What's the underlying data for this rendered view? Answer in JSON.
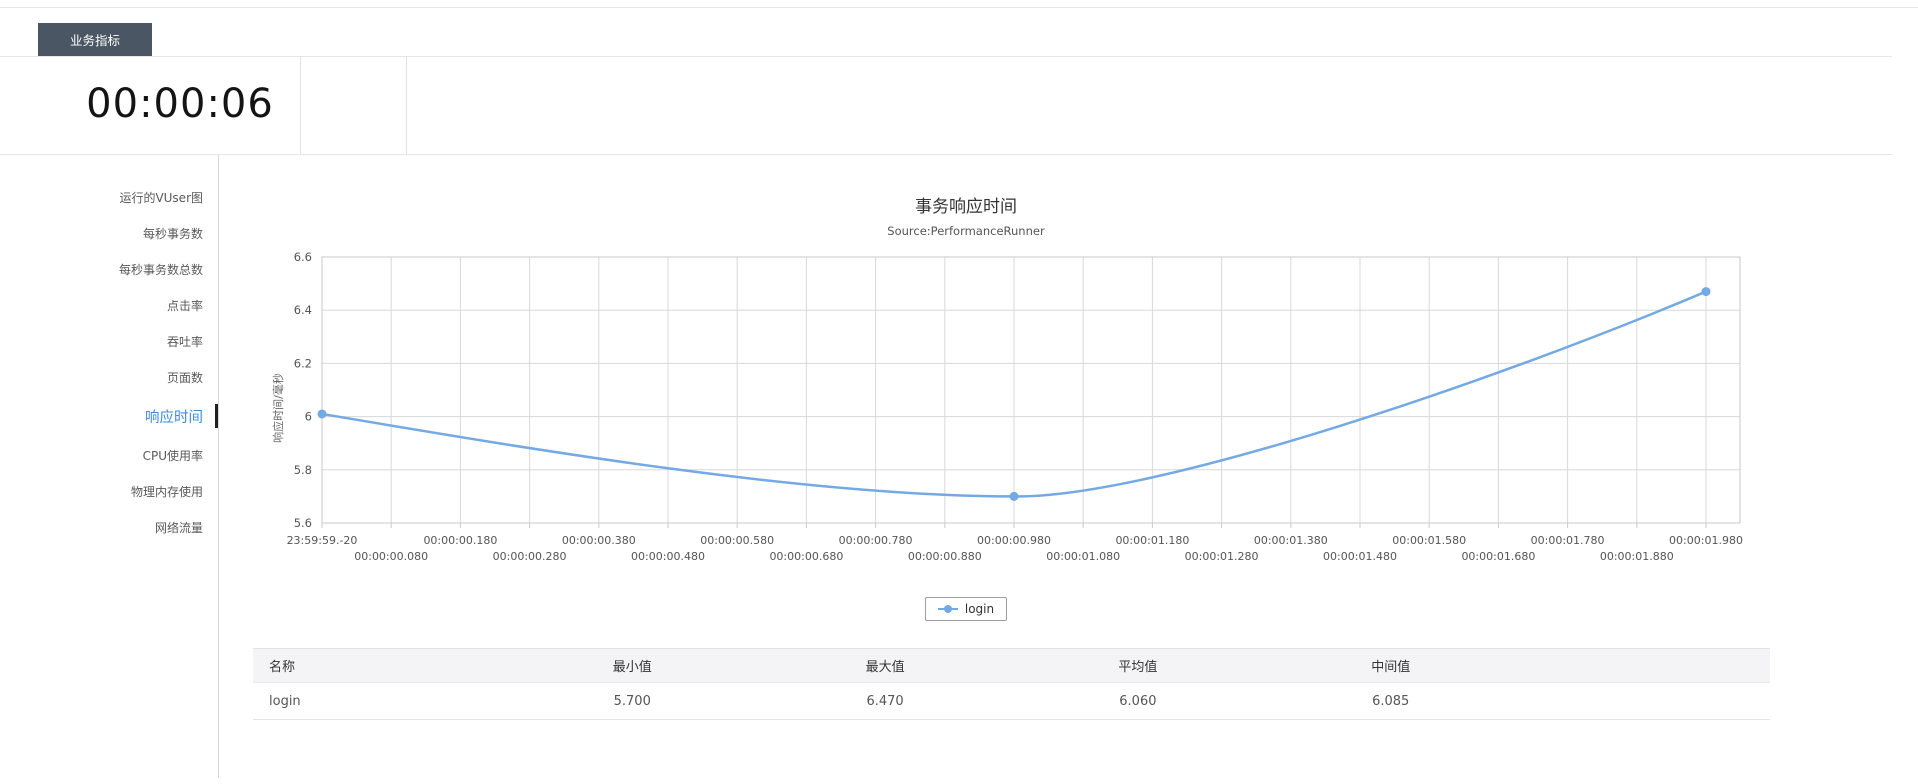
{
  "tab": {
    "label": "业务指标"
  },
  "timer": {
    "value": "00:00:06"
  },
  "sidebar": {
    "items": [
      {
        "label": "运行的VUser图",
        "active": false
      },
      {
        "label": "每秒事务数",
        "active": false
      },
      {
        "label": "每秒事务数总数",
        "active": false
      },
      {
        "label": "点击率",
        "active": false
      },
      {
        "label": "吞吐率",
        "active": false
      },
      {
        "label": "页面数",
        "active": false
      },
      {
        "label": "响应时间",
        "active": true
      },
      {
        "label": "CPU使用率",
        "active": false
      },
      {
        "label": "物理内存使用",
        "active": false
      },
      {
        "label": "网络流量",
        "active": false
      }
    ]
  },
  "chart_data": {
    "type": "line",
    "title": "事务响应时间",
    "subtitle": "Source:PerformanceRunner",
    "ylabel": "响应时间/毫秒",
    "ylim": [
      5.6,
      6.6
    ],
    "grid": true,
    "legend_position": "bottom",
    "yticks": [
      {
        "value": 6.6,
        "label": "6.6"
      },
      {
        "value": 6.4,
        "label": "6.4"
      },
      {
        "value": 6.2,
        "label": "6.2"
      },
      {
        "value": 6.0,
        "label": "6"
      },
      {
        "value": 5.8,
        "label": "5.8"
      },
      {
        "value": 5.6,
        "label": "5.6"
      }
    ],
    "xticklabels": [
      "23:59:59.-20",
      "00:00:00.080",
      "00:00:00.180",
      "00:00:00.280",
      "00:00:00.380",
      "00:00:00.480",
      "00:00:00.580",
      "00:00:00.680",
      "00:00:00.780",
      "00:00:00.880",
      "00:00:00.980",
      "00:00:01.080",
      "00:00:01.180",
      "00:00:01.280",
      "00:00:01.380",
      "00:00:01.480",
      "00:00:01.580",
      "00:00:01.680",
      "00:00:01.780",
      "00:00:01.880",
      "00:00:01.980"
    ],
    "series": [
      {
        "name": "login",
        "color": "#73a9e5",
        "points": [
          {
            "tick": 0,
            "x_label": "23:59:59.-20",
            "y": 6.01
          },
          {
            "tick": 10,
            "x_label": "00:00:00.980",
            "y": 5.7
          },
          {
            "tick": 20,
            "x_label": "00:00:01.980",
            "y": 6.47
          }
        ]
      }
    ]
  },
  "summary_table": {
    "headers": [
      "名称",
      "最小值",
      "最大值",
      "平均值",
      "中间值"
    ],
    "rows": [
      [
        "login",
        "5.700",
        "6.470",
        "6.060",
        "6.085"
      ]
    ]
  },
  "colors": {
    "tab_background": "#4a5663",
    "active_item": "#3c8edc",
    "series_line": "#73a9e5",
    "grid_line": "#d8d8d8",
    "axis_border": "#c9c9c9",
    "axis_label": "#555555"
  }
}
